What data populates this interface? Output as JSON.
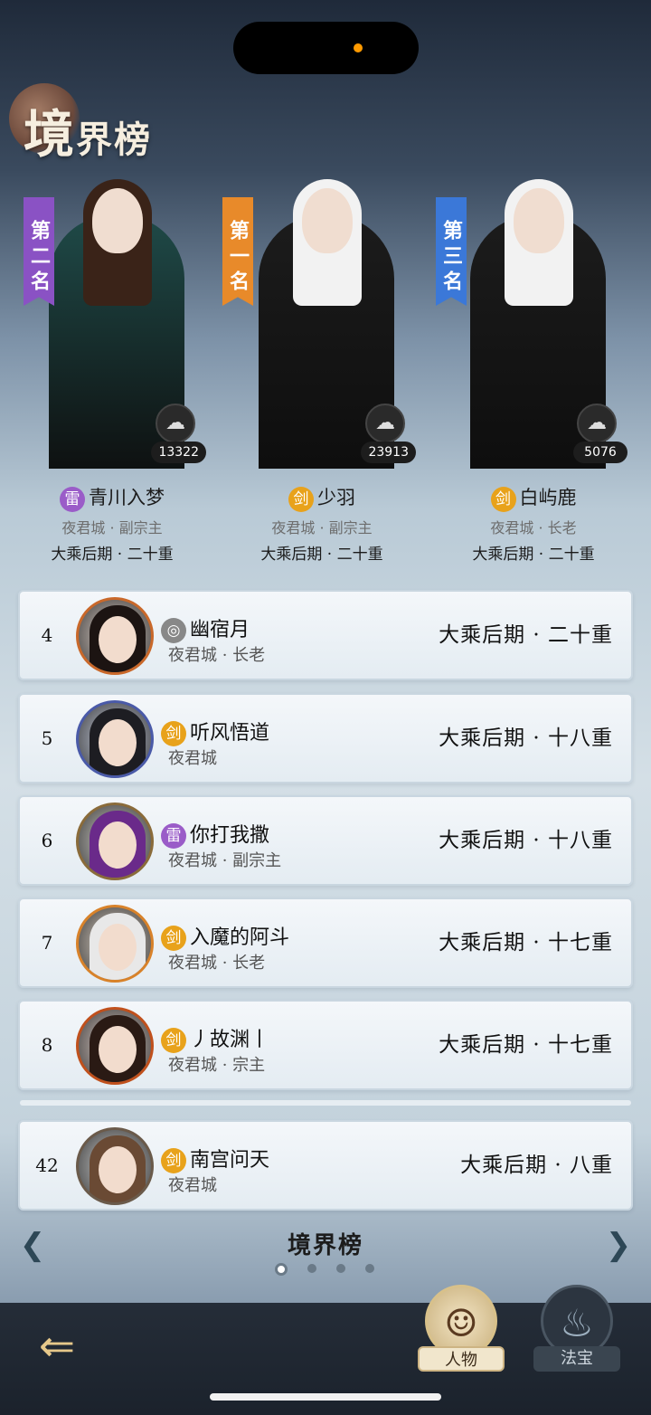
{
  "header": {
    "title_first": "境",
    "title_rest": "界榜"
  },
  "podium": [
    {
      "rank_label": "第二名",
      "name": "青川入梦",
      "element": "雷",
      "element_type": "thunder",
      "sect": "夜君城 · 副宗主",
      "realm": "大乘后期 · 二十重",
      "power": "13322",
      "banner_color": "#8a52c4",
      "robe_color": "#1f4a48",
      "hair_color": "#3a2318"
    },
    {
      "rank_label": "第一名",
      "name": "少羽",
      "element": "剑",
      "element_type": "sword",
      "sect": "夜君城 · 副宗主",
      "realm": "大乘后期 · 二十重",
      "power": "23913",
      "banner_color": "#e88a2a",
      "robe_color": "#1c1c1c",
      "hair_color": "#f2f2f2"
    },
    {
      "rank_label": "第三名",
      "name": "白屿鹿",
      "element": "剑",
      "element_type": "sword",
      "sect": "夜君城 · 长老",
      "realm": "大乘后期 · 二十重",
      "power": "5076",
      "banner_color": "#3b78d8",
      "robe_color": "#1c1c1c",
      "hair_color": "#f2f2f2"
    }
  ],
  "rows": [
    {
      "rank": "4",
      "name": "幽宿月",
      "element": "",
      "element_type": "wind",
      "sect": "夜君城 · 长老",
      "realm": "大乘后期 · 二十重",
      "frame_color": "#c9682a",
      "hair_color": "#1c1412"
    },
    {
      "rank": "5",
      "name": "听风悟道",
      "element": "剑",
      "element_type": "sword",
      "sect": "夜君城",
      "realm": "大乘后期 · 十八重",
      "frame_color": "#4a5aa8",
      "hair_color": "#1d1d22"
    },
    {
      "rank": "6",
      "name": "你打我撒",
      "element": "雷",
      "element_type": "thunder",
      "sect": "夜君城 · 副宗主",
      "realm": "大乘后期 · 十八重",
      "frame_color": "#8a6b3a",
      "hair_color": "#6a2a8a"
    },
    {
      "rank": "7",
      "name": "入魔的阿斗",
      "element": "剑",
      "element_type": "sword",
      "sect": "夜君城 · 长老",
      "realm": "大乘后期 · 十七重",
      "frame_color": "#d8822a",
      "hair_color": "#e8e8e8"
    },
    {
      "rank": "8",
      "name": "丿故渊丨",
      "element": "剑",
      "element_type": "sword",
      "sect": "夜君城 · 宗主",
      "realm": "大乘后期 · 十七重",
      "frame_color": "#c0501c",
      "hair_color": "#2a1a14"
    },
    {
      "rank": "42",
      "name": "南宫问天",
      "element": "剑",
      "element_type": "sword",
      "sect": "夜君城",
      "realm": "大乘后期 · 八重",
      "frame_color": "#6a5a4a",
      "hair_color": "#6a4a34"
    }
  ],
  "footer": {
    "title": "境界榜",
    "prev_icon": "arrow-left-icon",
    "next_icon": "arrow-right-icon",
    "pages": 4,
    "active_page": 1
  },
  "tabs": {
    "people": "人物",
    "treasure": "法宝"
  },
  "back_icon": "back-arrow-icon"
}
